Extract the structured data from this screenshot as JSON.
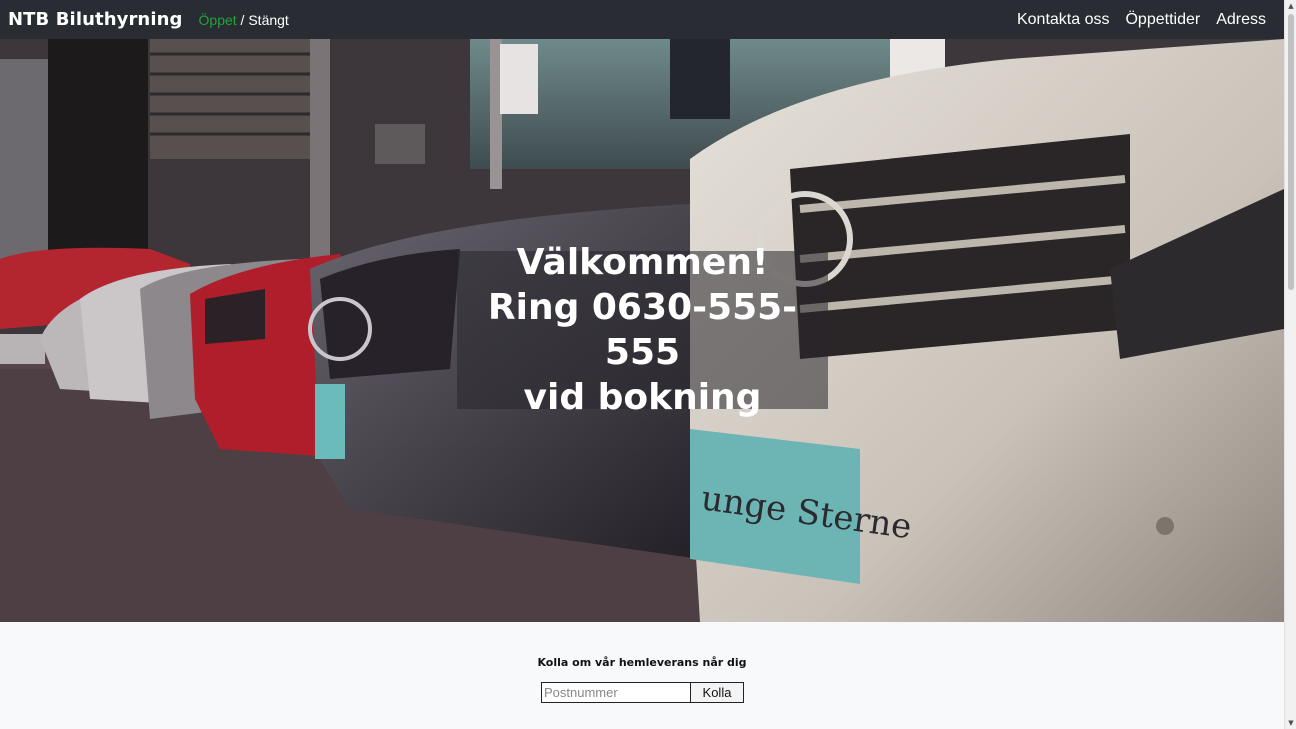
{
  "navbar": {
    "brand": "NTB Biluthyrning",
    "status_open": "Öppet",
    "status_separator": " / ",
    "status_closed": "Stängt",
    "links": [
      "Kontakta oss",
      "Öppettider",
      "Adress"
    ]
  },
  "hero": {
    "line1": "Välkommen!",
    "line2": "Ring 0630-555-555",
    "line3": "vid bokning"
  },
  "delivery": {
    "title": "Kolla om vår hemleverans når dig",
    "input_placeholder": "Postnummer",
    "button_label": "Kolla"
  },
  "scrollbar": {
    "up_icon": "▲",
    "down_icon": "▼"
  },
  "colors": {
    "navbar_bg": "#292d33",
    "status_open": "#22a33a",
    "page_bg": "#f8f9fa"
  }
}
